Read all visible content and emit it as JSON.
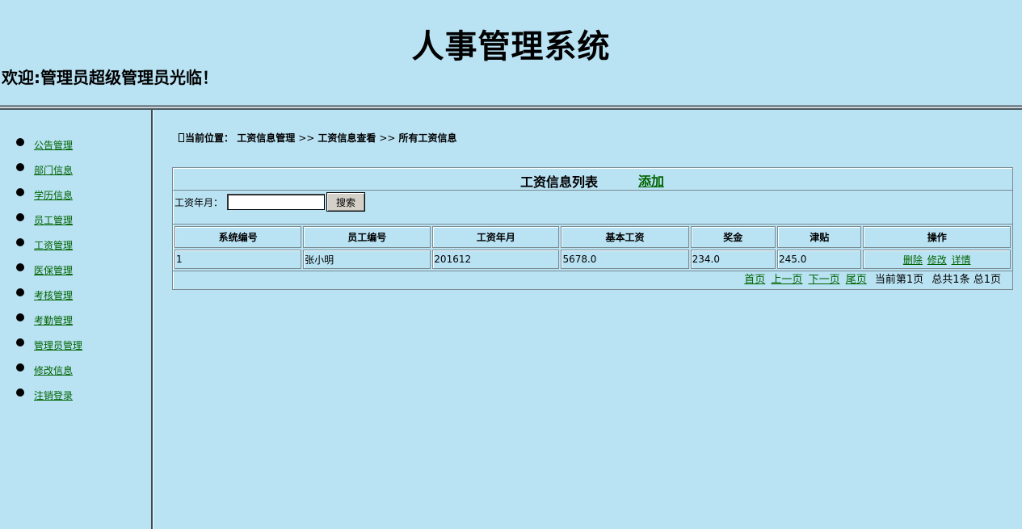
{
  "header": {
    "title": "人事管理系统",
    "welcome": "欢迎:管理员超级管理员光临！"
  },
  "sidebar": {
    "items": [
      {
        "label": "公告管理"
      },
      {
        "label": "部门信息"
      },
      {
        "label": "学历信息"
      },
      {
        "label": "员工管理"
      },
      {
        "label": "工资管理"
      },
      {
        "label": "医保管理"
      },
      {
        "label": "考核管理"
      },
      {
        "label": "考勤管理"
      },
      {
        "label": "管理员管理"
      },
      {
        "label": "修改信息"
      },
      {
        "label": "注销登录"
      }
    ]
  },
  "breadcrumb": {
    "prefix": "当前位置：",
    "level1": "工资信息管理",
    "level2": "工资信息查看",
    "level3": "所有工资信息",
    "separator": ">>"
  },
  "panel": {
    "title": "工资信息列表",
    "add_label": "添加",
    "search_label": "工资年月：",
    "search_value": "",
    "search_button": "搜索"
  },
  "table": {
    "columns": [
      "系统编号",
      "员工编号",
      "工资年月",
      "基本工资",
      "奖金",
      "津贴",
      "操作"
    ],
    "rows": [
      {
        "id": "1",
        "employee": "张小明",
        "month": "201612",
        "base": "5678.0",
        "bonus": "234.0",
        "allowance": "245.0",
        "actions": [
          "删除",
          "修改",
          "详情"
        ]
      }
    ]
  },
  "pager": {
    "first": "首页",
    "prev": "上一页",
    "next": "下一页",
    "last": "尾页",
    "current": "当前第1页",
    "total_records": "总共1条",
    "total_pages": "总1页"
  }
}
